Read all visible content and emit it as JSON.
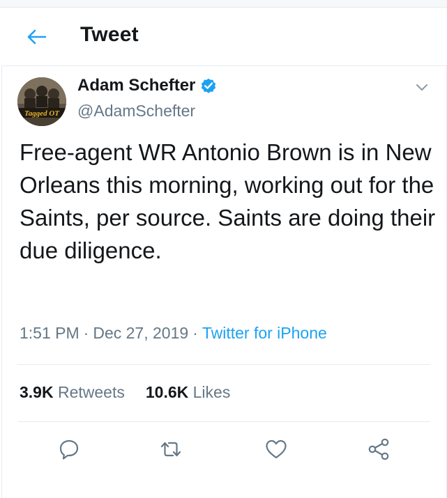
{
  "header": {
    "title": "Tweet"
  },
  "tweet": {
    "author": {
      "name": "Adam Schefter",
      "handle": "@AdamSchefter",
      "verified": true,
      "avatar_text": "Tagged OT"
    },
    "text": "Free-agent WR Antonio Brown is in New Orleans this morning, working out for the Saints, per source. Saints are doing their due diligence.",
    "time": "1:51 PM",
    "date": "Dec 27, 2019",
    "separator": "·",
    "source": "Twitter for iPhone",
    "stats": {
      "retweets_count": "3.9K",
      "retweets_label": "Retweets",
      "likes_count": "10.6K",
      "likes_label": "Likes"
    }
  },
  "icons": {
    "back": "arrow-left-icon",
    "verified": "verified-badge-icon",
    "caret": "chevron-down-icon",
    "reply": "reply-icon",
    "retweet": "retweet-icon",
    "like": "heart-icon",
    "share": "share-icon"
  },
  "colors": {
    "accent": "#1da1f2",
    "text": "#14171a",
    "secondary": "#657786",
    "divider": "#e6ecf0"
  }
}
